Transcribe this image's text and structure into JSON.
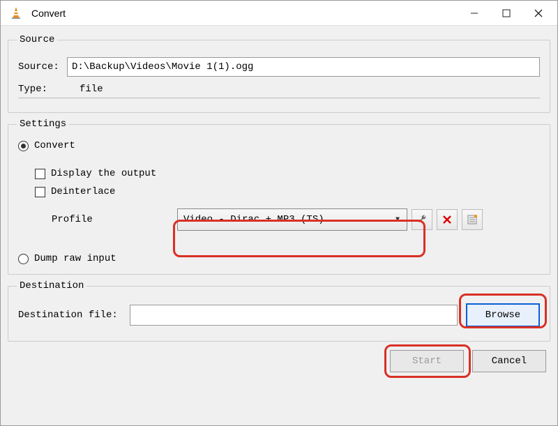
{
  "window": {
    "title": "Convert"
  },
  "source": {
    "legend": "Source",
    "source_label": "Source:",
    "source_value": "D:\\Backup\\Videos\\Movie 1(1).ogg",
    "type_label": "Type:",
    "type_value": "file"
  },
  "settings": {
    "legend": "Settings",
    "convert_label": "Convert",
    "display_output_label": "Display the output",
    "deinterlace_label": "Deinterlace",
    "profile_label": "Profile",
    "profile_value": "Video - Dirac + MP3 (TS)",
    "dump_label": "Dump raw input"
  },
  "destination": {
    "legend": "Destination",
    "file_label": "Destination file:",
    "file_value": "",
    "browse_label": "Browse"
  },
  "buttons": {
    "start": "Start",
    "cancel": "Cancel"
  },
  "icons": {
    "wrench": "wrench-icon",
    "delete": "delete-icon",
    "list": "list-icon"
  }
}
